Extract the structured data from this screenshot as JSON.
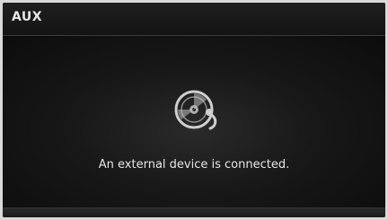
{
  "header": {
    "title": "AUX"
  },
  "main": {
    "icon": "external-device-icon",
    "message": "An external device is connected."
  }
}
